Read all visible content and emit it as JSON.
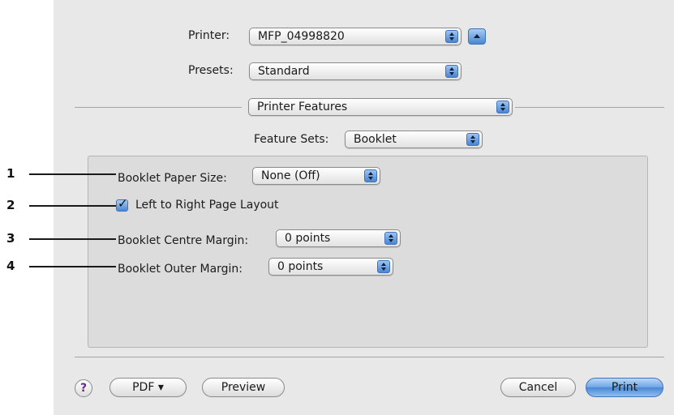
{
  "header": {
    "printer_label": "Printer:",
    "printer_value": "MFP_04998820",
    "presets_label": "Presets:",
    "presets_value": "Standard",
    "pane_value": "Printer Features",
    "feature_sets_label": "Feature Sets:",
    "feature_sets_value": "Booklet"
  },
  "booklet": {
    "paper_size_label": "Booklet Paper Size:",
    "paper_size_value": "None (Off)",
    "left_to_right_label": "Left to Right Page Layout",
    "left_to_right_checked": true,
    "centre_margin_label": "Booklet Centre Margin:",
    "centre_margin_value": "0 points",
    "outer_margin_label": "Booklet Outer Margin:",
    "outer_margin_value": "0 points"
  },
  "callouts": [
    "1",
    "2",
    "3",
    "4"
  ],
  "footer": {
    "help": "?",
    "pdf": "PDF ▾",
    "preview": "Preview",
    "cancel": "Cancel",
    "print": "Print"
  },
  "icons": {
    "expand": "expand-up-icon",
    "popup_arrows": "updown-arrows-icon",
    "check": "checkmark-icon"
  },
  "colors": {
    "accent": "#4a86d4",
    "dialog_bg": "#e8e8e8"
  }
}
